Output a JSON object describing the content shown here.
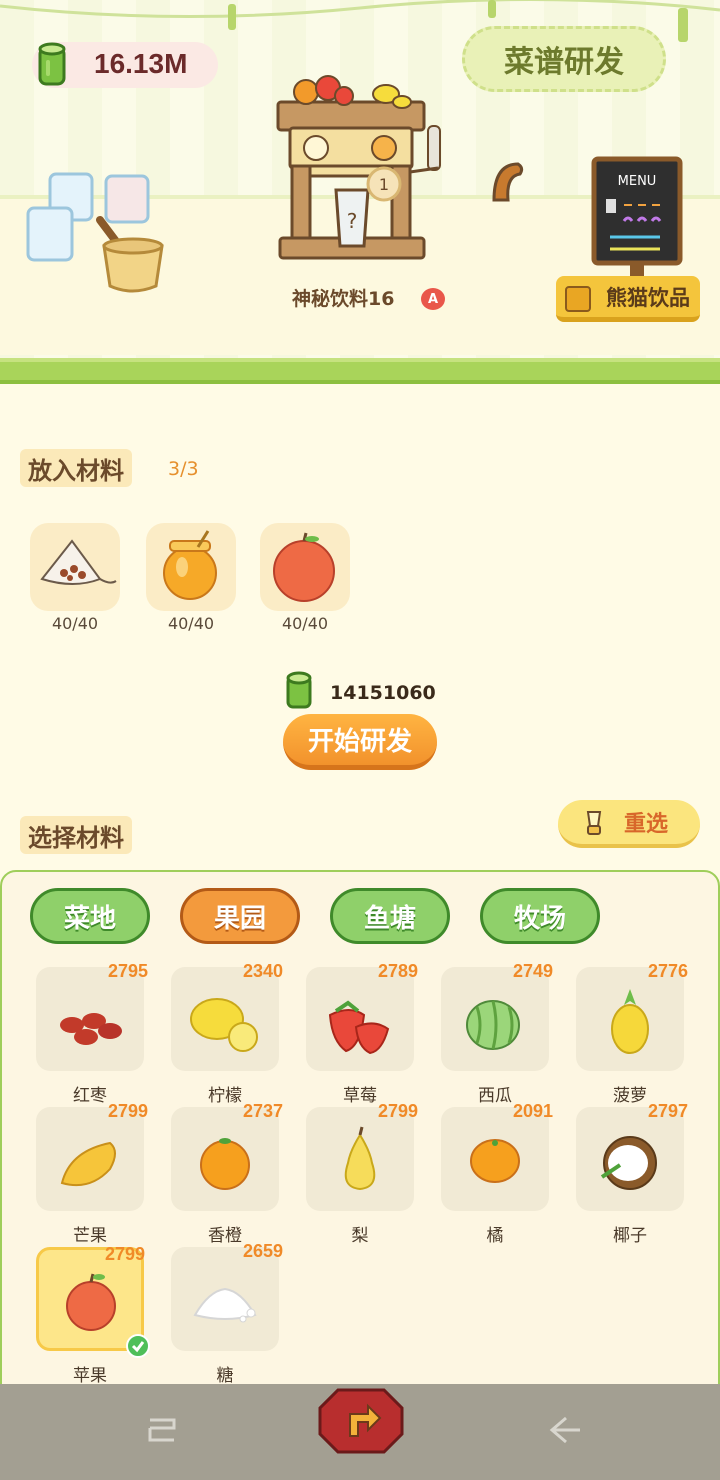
{
  "header": {
    "coins": "16.13M",
    "recipe_button": "菜谱研发"
  },
  "machine": {
    "queue_count": "1",
    "name": "神秘饮料16",
    "grade": "A"
  },
  "shop": {
    "label": "熊猫饮品",
    "menu_title": "MENU"
  },
  "ingredients": {
    "title": "放入材料",
    "count": "3/3",
    "slots": [
      {
        "name": "tea-bag",
        "count": "40/40"
      },
      {
        "name": "honey-jar",
        "count": "40/40"
      },
      {
        "name": "apple",
        "count": "40/40"
      }
    ]
  },
  "research": {
    "cost": "14151060",
    "start_button": "开始研发"
  },
  "select": {
    "title": "选择材料",
    "reset_button": "重选"
  },
  "categories": [
    {
      "label": "菜地",
      "active": false
    },
    {
      "label": "果园",
      "active": true
    },
    {
      "label": "鱼塘",
      "active": false
    },
    {
      "label": "牧场",
      "active": false
    }
  ],
  "items": [
    {
      "label": "红枣",
      "qty": "2795"
    },
    {
      "label": "柠檬",
      "qty": "2340"
    },
    {
      "label": "草莓",
      "qty": "2789"
    },
    {
      "label": "西瓜",
      "qty": "2749"
    },
    {
      "label": "菠萝",
      "qty": "2776"
    },
    {
      "label": "芒果",
      "qty": "2799"
    },
    {
      "label": "香橙",
      "qty": "2737"
    },
    {
      "label": "梨",
      "qty": "2799"
    },
    {
      "label": "橘",
      "qty": "2091"
    },
    {
      "label": "椰子",
      "qty": "2797"
    },
    {
      "label": "苹果",
      "qty": "2799",
      "selected": true
    },
    {
      "label": "糖",
      "qty": "2659"
    }
  ],
  "colors": {
    "accent_orange": "#f39a3d",
    "tab_green": "#8fd06a",
    "qty_orange": "#f08a28",
    "background": "#fffbe6"
  }
}
